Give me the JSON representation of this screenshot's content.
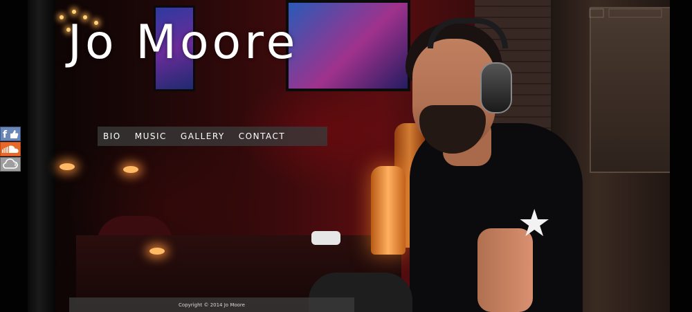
{
  "header": {
    "title": "Jo Moore"
  },
  "nav": {
    "items": [
      "BIO",
      "MUSIC",
      "GALLERY",
      "CONTACT"
    ]
  },
  "social": {
    "items": [
      {
        "name": "facebook",
        "icon": "facebook-like-icon",
        "color": "#6b87b8"
      },
      {
        "name": "soundcloud",
        "icon": "soundcloud-icon",
        "color": "#e8682a"
      },
      {
        "name": "mixcloud",
        "icon": "cloud-icon",
        "color": "#9e9e9e"
      }
    ]
  },
  "footer": {
    "copyright": "Copyright © 2014 Jo Moore"
  },
  "hero": {
    "subject": "dj-with-headphones-photo"
  }
}
